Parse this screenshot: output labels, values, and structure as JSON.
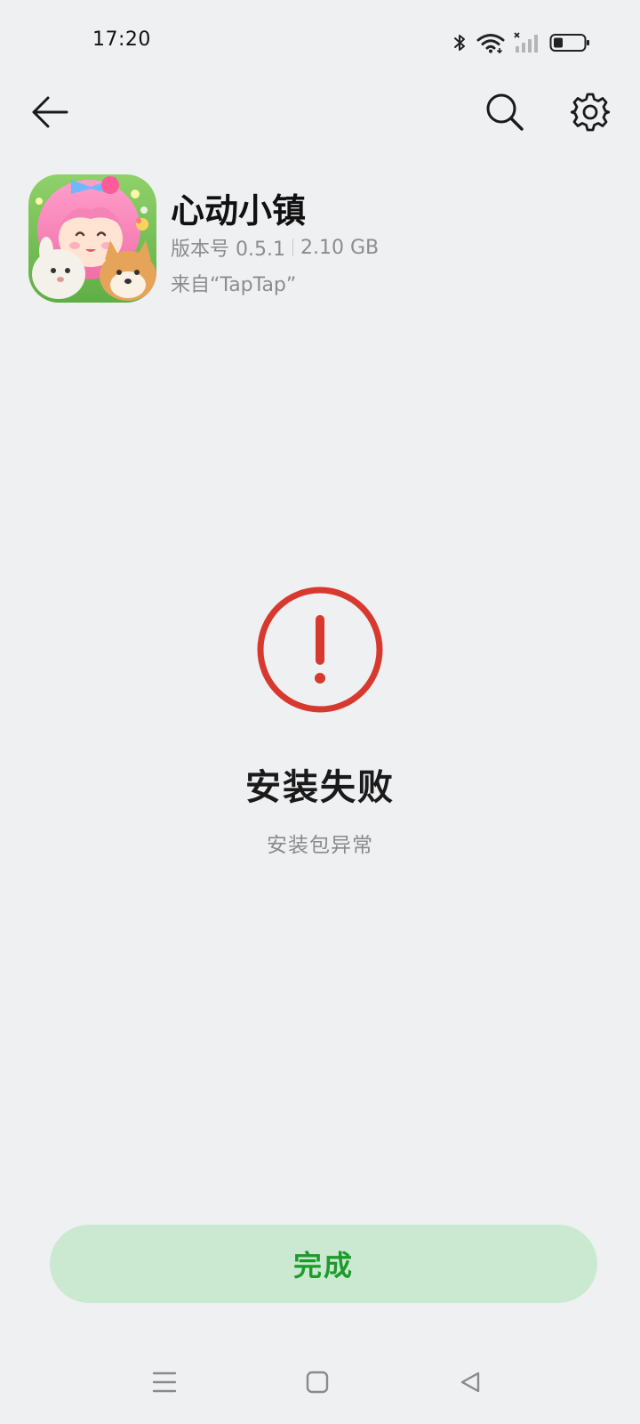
{
  "status_bar": {
    "time": "17:20",
    "icons": [
      "bluetooth-icon",
      "wifi-icon",
      "signal-icon",
      "battery-icon"
    ]
  },
  "toolbar": {
    "back_icon": "arrow-left-icon",
    "search_icon": "search-icon",
    "settings_icon": "gear-icon"
  },
  "app": {
    "name": "心动小镇",
    "version": "版本号 0.5.1",
    "size": "2.10 GB",
    "source": "来自“TapTap”"
  },
  "result": {
    "status_icon": "error-exclamation-icon",
    "title": "安装失败",
    "reason": "安装包异常",
    "accent_color": "#d8392f"
  },
  "actions": {
    "done_label": "完成",
    "done_bg": "#cbe9d1",
    "done_color": "#1e9a2c"
  },
  "navigation": {
    "items": [
      "menu-icon",
      "home-icon",
      "back-triangle-icon"
    ]
  }
}
